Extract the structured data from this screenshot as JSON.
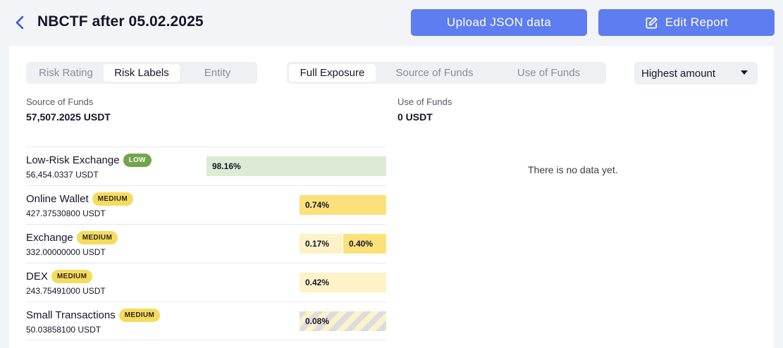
{
  "header": {
    "title": "NBCTF after 05.02.2025",
    "upload_label": "Upload JSON data",
    "edit_label": "Edit Report"
  },
  "tabs_group1": [
    {
      "label": "Risk Rating",
      "active": false
    },
    {
      "label": "Risk Labels",
      "active": true
    },
    {
      "label": "Entity",
      "active": false
    }
  ],
  "tabs_group2": [
    {
      "label": "Full Exposure",
      "active": true
    },
    {
      "label": "Source of Funds",
      "active": false
    },
    {
      "label": "Use of Funds",
      "active": false
    }
  ],
  "sort": {
    "selected": "Highest amount"
  },
  "source": {
    "label": "Source of Funds",
    "value": "57,507.2025 USDT"
  },
  "use": {
    "label": "Use of Funds",
    "value": "0 USDT",
    "empty_text": "There is no data yet."
  },
  "rows": [
    {
      "name": "Low-Risk Exchange",
      "badge": "LOW",
      "badge_level": "low",
      "amount": "56,454.0337 USDT",
      "bars": [
        {
          "label": "98.16%",
          "style": "green"
        }
      ]
    },
    {
      "name": "Online Wallet",
      "badge": "MEDIUM",
      "badge_level": "medium",
      "amount": "427.37530800 USDT",
      "bars": [
        {
          "label": "0.74%",
          "style": "yellow"
        }
      ]
    },
    {
      "name": "Exchange",
      "badge": "MEDIUM",
      "badge_level": "medium",
      "amount": "332.00000000 USDT",
      "bars": [
        {
          "label": "0.17%",
          "style": "lightyellow"
        },
        {
          "label": "0.40%",
          "style": "yellow"
        }
      ]
    },
    {
      "name": "DEX",
      "badge": "MEDIUM",
      "badge_level": "medium",
      "amount": "243.75491000 USDT",
      "bars": [
        {
          "label": "0.42%",
          "style": "lightyellow"
        }
      ]
    },
    {
      "name": "Small Transactions",
      "badge": "MEDIUM",
      "badge_level": "medium",
      "amount": "50.03858100 USDT",
      "bars": [
        {
          "label": "0.08%",
          "style": "striped"
        }
      ]
    }
  ],
  "colors": {
    "accent": "#5d7df0",
    "low": "#72a44a",
    "medium": "#f6db5c"
  }
}
